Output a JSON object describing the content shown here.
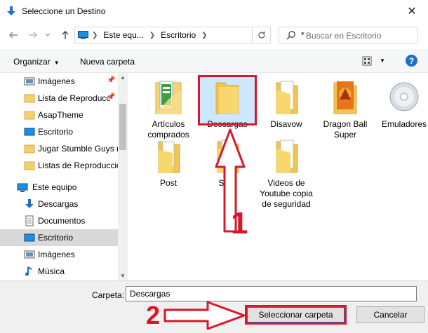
{
  "window": {
    "title": "Seleccione un Destino",
    "close_glyph": "✕"
  },
  "address": {
    "crumbs": [
      "Este equ...",
      "Escritorio"
    ],
    "search_placeholder": "Buscar en Escritorio"
  },
  "toolbar": {
    "organize_label": "Organizar",
    "new_folder_label": "Nueva carpeta",
    "help_label": "?"
  },
  "sidebar": {
    "items": [
      {
        "label": "Imágenes",
        "icon": "pictures-icon",
        "pinned": true
      },
      {
        "label": "Lista de Reproducc",
        "icon": "folder-icon",
        "pinned": true
      },
      {
        "label": "AsapTheme",
        "icon": "folder-icon",
        "pinned": false
      },
      {
        "label": "Escritorio",
        "icon": "desktop-icon",
        "pinned": false
      },
      {
        "label": "Jugar Stumble Guys n",
        "icon": "folder-icon",
        "pinned": false
      },
      {
        "label": "Listas de Reproducció",
        "icon": "folder-icon",
        "pinned": false
      },
      {
        "label": "Este equipo",
        "icon": "computer-icon",
        "pinned": false
      },
      {
        "label": "Descargas",
        "icon": "downloads-icon",
        "pinned": false
      },
      {
        "label": "Documentos",
        "icon": "documents-icon",
        "pinned": false
      },
      {
        "label": "Escritorio",
        "icon": "desktop-icon",
        "pinned": false,
        "selected": true
      },
      {
        "label": "Imágenes",
        "icon": "pictures-icon",
        "pinned": false
      },
      {
        "label": "Música",
        "icon": "music-icon",
        "pinned": false
      }
    ]
  },
  "files": [
    {
      "name": "Artículos comprados",
      "icon": "green-folder-icon"
    },
    {
      "name": "Descargas",
      "icon": "folder-icon",
      "selected": true
    },
    {
      "name": "Disavow",
      "icon": "folder-docs-icon"
    },
    {
      "name": "Dragon Ball Super",
      "icon": "dragon-folder-icon"
    },
    {
      "name": "Emuladores",
      "icon": "cd-icon"
    },
    {
      "name": "Post",
      "icon": "folder-icon"
    },
    {
      "name": "SEO",
      "icon": "folder-docs-icon"
    },
    {
      "name": "Videos de Youtube copia de seguridad",
      "icon": "folder-docs-icon"
    }
  ],
  "annotations": {
    "step1": "1",
    "step2": "2",
    "color": "#d9172b"
  },
  "bottom": {
    "folder_label": "Carpeta:",
    "folder_value": "Descargas",
    "select_button": "Seleccionar carpeta",
    "cancel_button": "Cancelar"
  }
}
